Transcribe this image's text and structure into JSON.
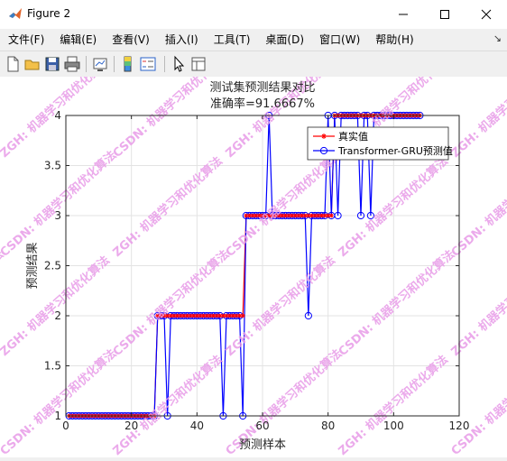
{
  "window": {
    "title": "Figure 2"
  },
  "menu": [
    {
      "label": "文件(F)"
    },
    {
      "label": "编辑(E)"
    },
    {
      "label": "查看(V)"
    },
    {
      "label": "插入(I)"
    },
    {
      "label": "工具(T)"
    },
    {
      "label": "桌面(D)"
    },
    {
      "label": "窗口(W)"
    },
    {
      "label": "帮助(H)"
    }
  ],
  "toolbar": [
    {
      "icon": "new-figure-icon"
    },
    {
      "icon": "open-file-icon"
    },
    {
      "icon": "save-icon"
    },
    {
      "icon": "print-icon"
    },
    {
      "icon": "link-plot-icon"
    },
    {
      "icon": "colorbar-icon"
    },
    {
      "icon": "legend-icon"
    },
    {
      "icon": "pointer-icon"
    },
    {
      "icon": "property-inspector-icon"
    }
  ],
  "watermark": {
    "lines": [
      "ZGH: 机器学习和优化算法",
      "CSDN: 机器学习和优化算法"
    ],
    "color": "#e79be8"
  },
  "chart_data": {
    "type": "line",
    "title": "测试集预测结果对比",
    "subtitle": "准确率=91.6667%",
    "xlabel": "预测样本",
    "ylabel": "预测结果",
    "xlim": [
      0,
      120
    ],
    "ylim": [
      1,
      4
    ],
    "xticks": [
      0,
      20,
      40,
      60,
      80,
      100,
      120
    ],
    "yticks": [
      1,
      1.5,
      2,
      2.5,
      3,
      3.5,
      4
    ],
    "grid": true,
    "legend_position": "top-right",
    "colors": {
      "truth": "#ff0000",
      "prediction": "#0000ff"
    },
    "series": [
      {
        "name": "真实值",
        "marker": "star",
        "values": [
          1,
          1,
          1,
          1,
          1,
          1,
          1,
          1,
          1,
          1,
          1,
          1,
          1,
          1,
          1,
          1,
          1,
          1,
          1,
          1,
          1,
          1,
          1,
          1,
          1,
          1,
          1,
          2,
          2,
          2,
          2,
          2,
          2,
          2,
          2,
          2,
          2,
          2,
          2,
          2,
          2,
          2,
          2,
          2,
          2,
          2,
          2,
          2,
          2,
          2,
          2,
          2,
          2,
          2,
          3,
          3,
          3,
          3,
          3,
          3,
          3,
          3,
          3,
          3,
          3,
          3,
          3,
          3,
          3,
          3,
          3,
          3,
          3,
          3,
          3,
          3,
          3,
          3,
          3,
          3,
          3,
          4,
          4,
          4,
          4,
          4,
          4,
          4,
          4,
          4,
          4,
          4,
          4,
          4,
          4,
          4,
          4,
          4,
          4,
          4,
          4,
          4,
          4,
          4,
          4,
          4,
          4,
          4
        ]
      },
      {
        "name": "Transformer-GRU预测值",
        "marker": "circle",
        "values": [
          1,
          1,
          1,
          1,
          1,
          1,
          1,
          1,
          1,
          1,
          1,
          1,
          1,
          1,
          1,
          1,
          1,
          1,
          1,
          1,
          1,
          1,
          1,
          1,
          1,
          1,
          1,
          2,
          2,
          2,
          1,
          2,
          2,
          2,
          2,
          2,
          2,
          2,
          2,
          2,
          2,
          2,
          2,
          2,
          2,
          2,
          2,
          1,
          2,
          2,
          2,
          2,
          2,
          1,
          3,
          3,
          3,
          3,
          3,
          3,
          3,
          4,
          3,
          3,
          3,
          3,
          3,
          3,
          3,
          3,
          3,
          3,
          3,
          2,
          3,
          3,
          3,
          3,
          3,
          4,
          3,
          4,
          3,
          4,
          4,
          4,
          4,
          4,
          4,
          3,
          4,
          4,
          3,
          4,
          4,
          4,
          4,
          4,
          4,
          4,
          4,
          4,
          4,
          4,
          4,
          4,
          4,
          4
        ]
      }
    ]
  }
}
